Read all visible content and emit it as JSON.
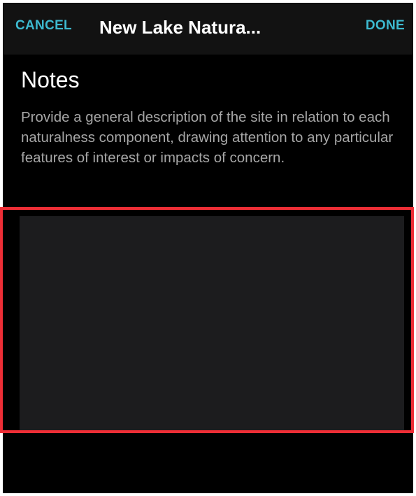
{
  "toolbar": {
    "cancel_label": "CANCEL",
    "title": "New Lake Natura...",
    "done_label": "DONE"
  },
  "notes": {
    "heading": "Notes",
    "description": "Provide a general description of the site in relation to each naturalness component, drawing attention to any particular features of interest or impacts of concern.",
    "value": ""
  },
  "colors": {
    "accent": "#3dbad0",
    "background": "#000000",
    "toolbar_background": "#121212",
    "input_background": "#1c1c1e",
    "highlight_border": "#ee2e36"
  }
}
